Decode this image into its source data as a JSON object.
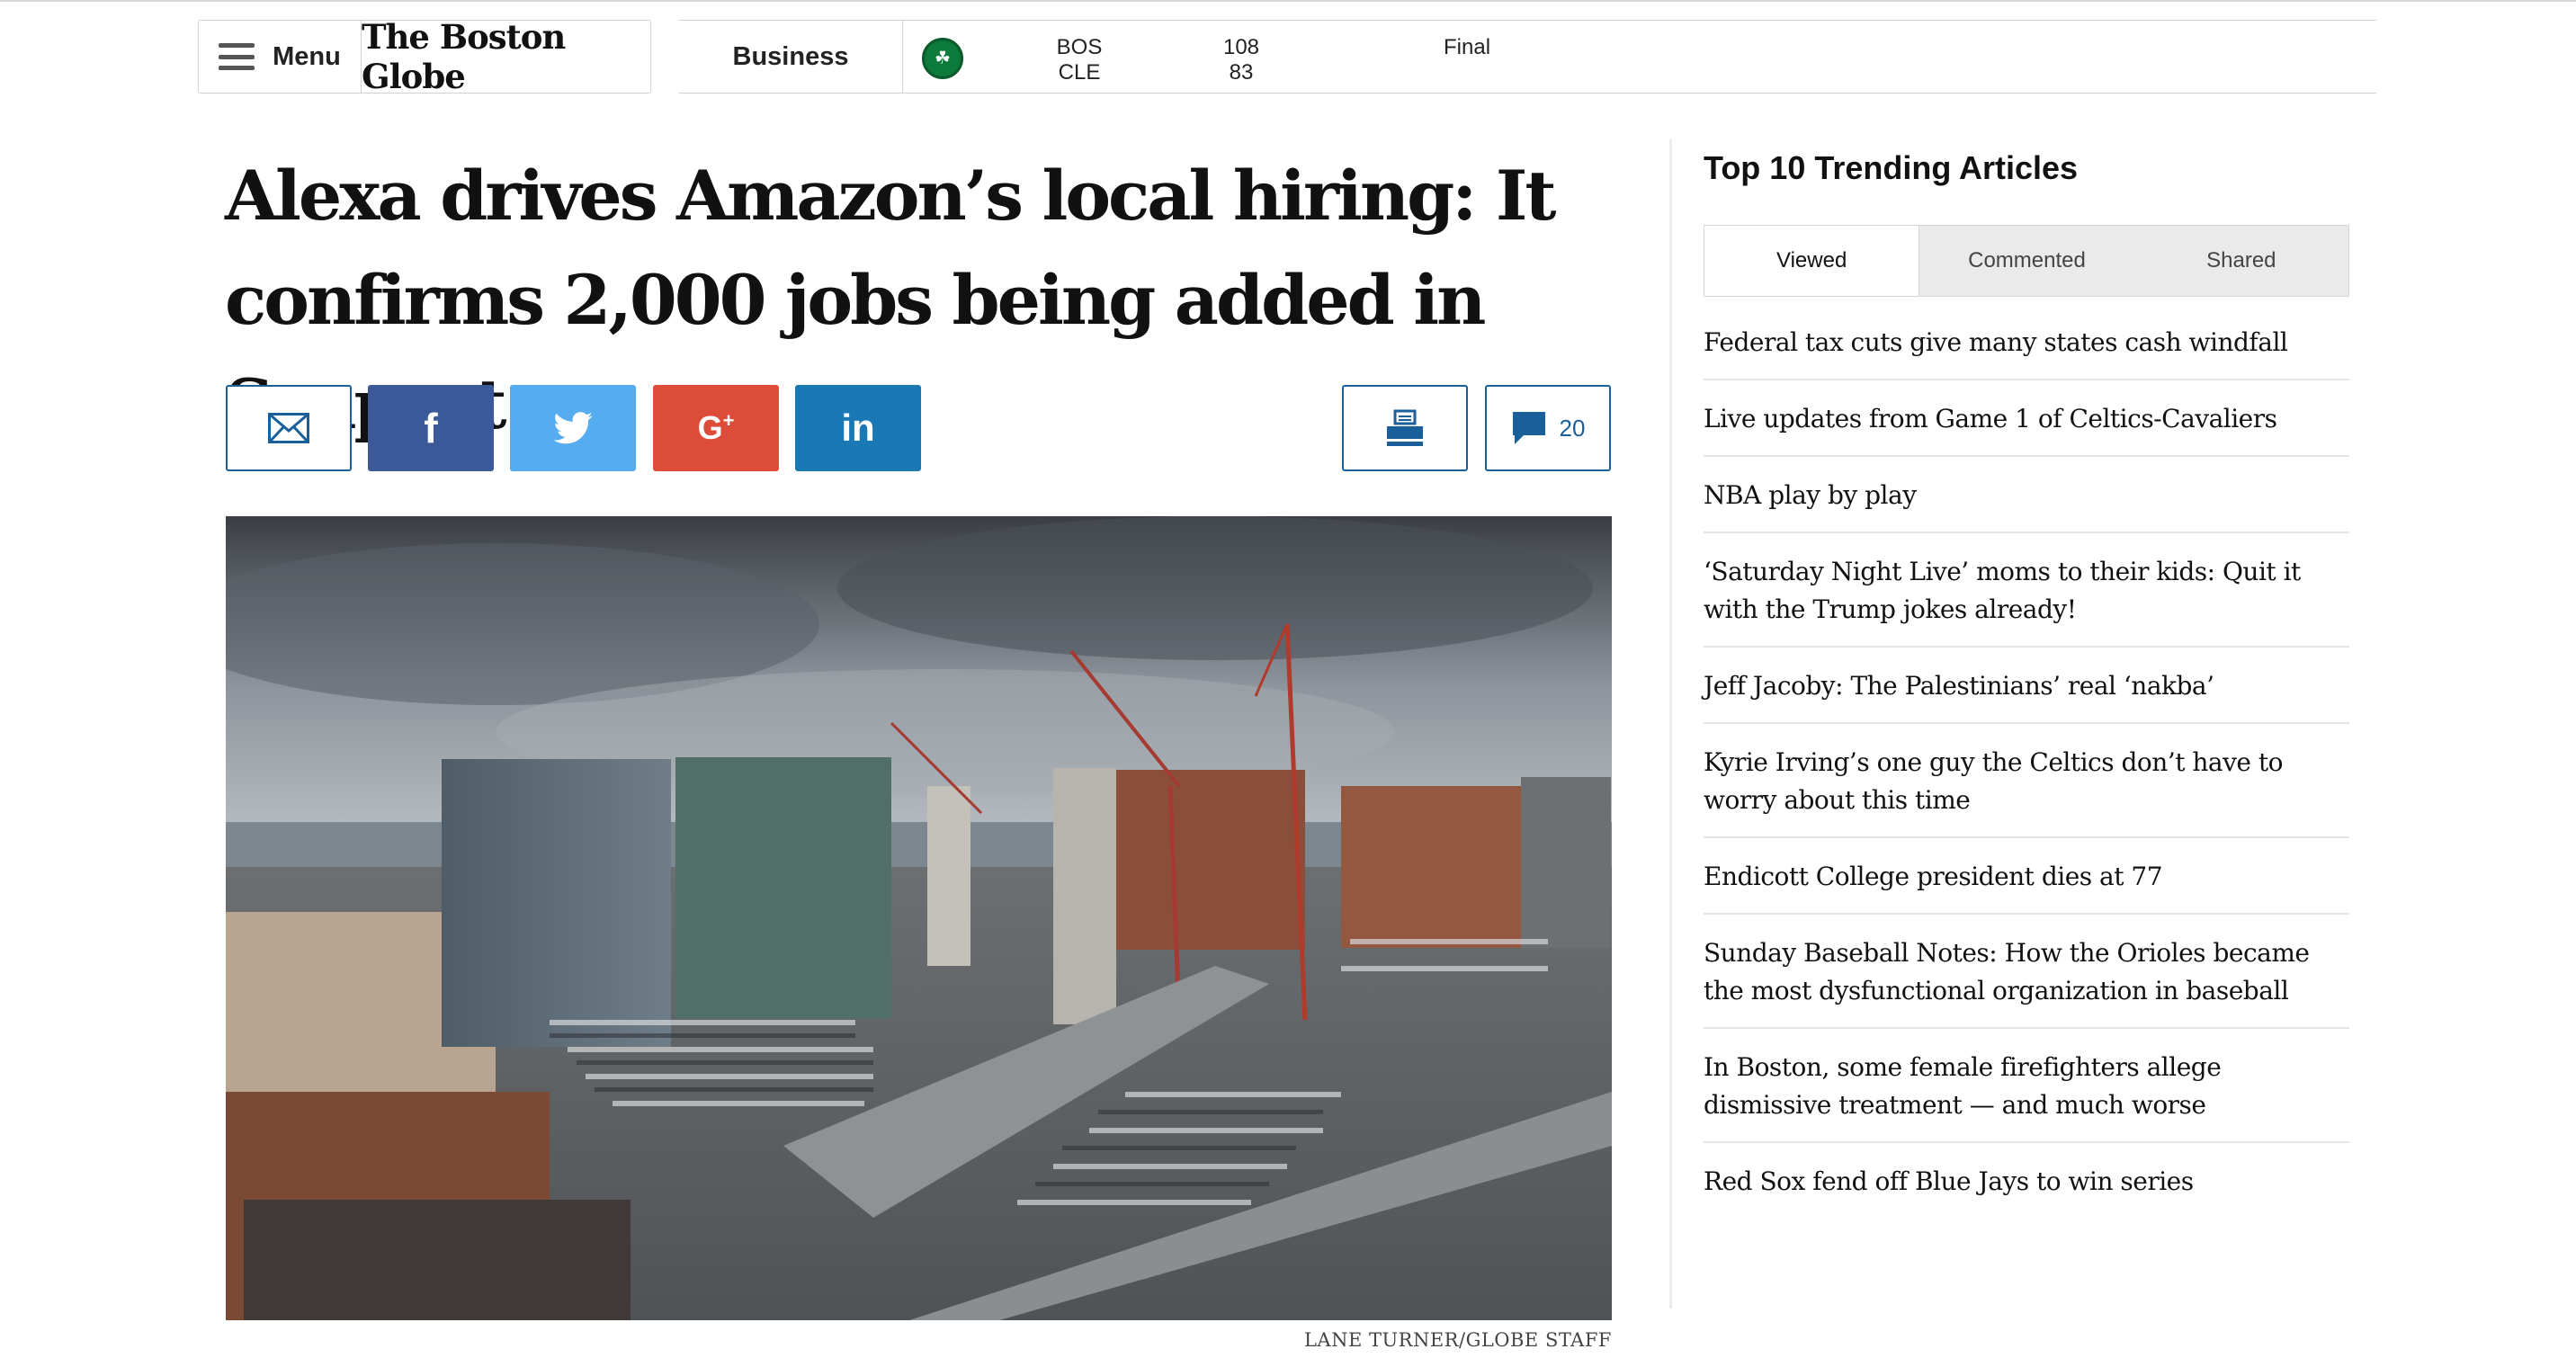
{
  "header": {
    "menu_label": "Menu",
    "logo_text": "The Boston Globe",
    "section": "Business",
    "scoreboard": {
      "icon": "celtics-logo-icon",
      "team_home": "BOS",
      "team_away": "CLE",
      "score_home": "108",
      "score_away": "83",
      "status": "Final"
    }
  },
  "article": {
    "headline": "Alexa drives Amazon’s local hiring: It confirms 2,000 jobs being added in Seaport",
    "comment_count": "20",
    "photo_credit": "LANE TURNER/GLOBE STAFF",
    "share_icons": [
      "email-icon",
      "facebook-icon",
      "twitter-icon",
      "google-plus-icon",
      "linkedin-icon",
      "print-icon",
      "comment-icon"
    ]
  },
  "colors": {
    "facebook": "#3b5998",
    "twitter": "#55acee",
    "google_plus": "#dd4b39",
    "linkedin": "#1a78b4",
    "outline_blue": "#1a5f99",
    "celtics_green": "#0b7a3a"
  },
  "trending": {
    "title": "Top 10 Trending Articles",
    "tabs": [
      "Viewed",
      "Commented",
      "Shared"
    ],
    "active_tab": "Viewed",
    "articles": [
      "Federal tax cuts give many states cash windfall",
      "Live updates from Game 1 of Celtics-Cavaliers",
      "NBA play by play",
      "‘Saturday Night Live’ moms to their kids: Quit it with the Trump jokes already!",
      "Jeff Jacoby: The Palestinians’ real ‘nakba’",
      "Kyrie Irving’s one guy the Celtics don’t have to worry about this time",
      "Endicott College president dies at 77",
      "Sunday Baseball Notes: How the Orioles became the most dysfunctional organization in baseball",
      "In Boston, some female firefighters allege dismissive treatment — and much worse",
      "Red Sox fend off Blue Jays to win series"
    ]
  }
}
